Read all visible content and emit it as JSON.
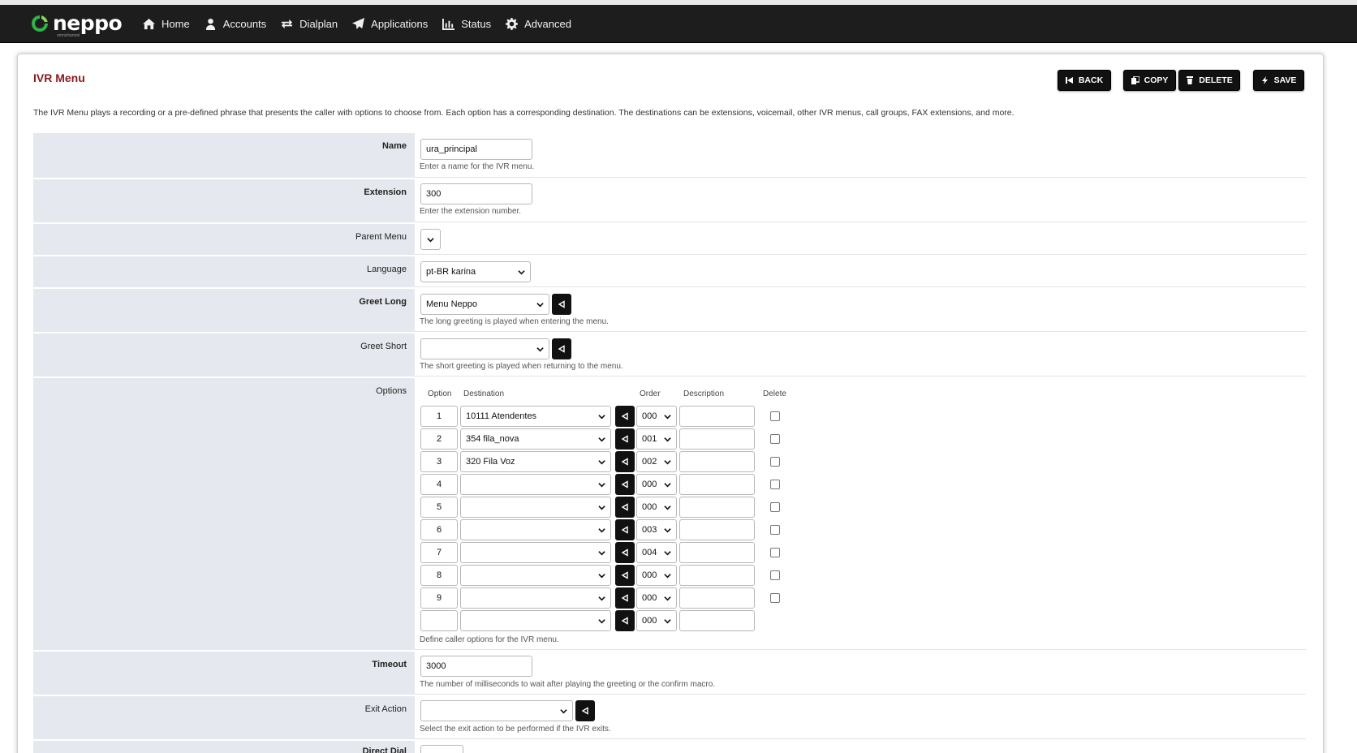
{
  "app": {
    "brand": "neppo",
    "brand_sub": "omnichannel"
  },
  "nav": {
    "items": [
      {
        "label": "Home",
        "icon": "home-icon"
      },
      {
        "label": "Accounts",
        "icon": "user-icon"
      },
      {
        "label": "Dialplan",
        "icon": "exchange-icon"
      },
      {
        "label": "Applications",
        "icon": "paper-plane-icon"
      },
      {
        "label": "Status",
        "icon": "bar-chart-icon"
      },
      {
        "label": "Advanced",
        "icon": "gear-icon"
      }
    ]
  },
  "page": {
    "title": "IVR Menu",
    "description": "The IVR Menu plays a recording or a pre-defined phrase that presents the caller with options to choose from. Each option has a corresponding destination. The destinations can be extensions, voicemail, other IVR menus, call groups, FAX extensions, and more."
  },
  "toolbar": {
    "back_label": "BACK",
    "copy_label": "COPY",
    "delete_label": "DELETE",
    "save_label": "SAVE"
  },
  "form": {
    "name": {
      "label": "Name",
      "value": "ura_principal",
      "hint": "Enter a name for the IVR menu."
    },
    "extension": {
      "label": "Extension",
      "value": "300",
      "hint": "Enter the extension number."
    },
    "parent_menu": {
      "label": "Parent Menu",
      "value": ""
    },
    "language": {
      "label": "Language",
      "value": "pt-BR karina"
    },
    "greet_long": {
      "label": "Greet Long",
      "value": "Menu Neppo",
      "hint": "The long greeting is played when entering the menu."
    },
    "greet_short": {
      "label": "Greet Short",
      "value": "",
      "hint": "The short greeting is played when returning to the menu."
    },
    "options": {
      "label": "Options",
      "headers": {
        "option": "Option",
        "destination": "Destination",
        "order": "Order",
        "description": "Description",
        "delete": "Delete"
      },
      "rows": [
        {
          "option": "1",
          "destination": "10111 Atendentes",
          "order": "000",
          "description": "",
          "deletable": true
        },
        {
          "option": "2",
          "destination": "354 fila_nova",
          "order": "001",
          "description": "",
          "deletable": true
        },
        {
          "option": "3",
          "destination": "320 Fila Voz",
          "order": "002",
          "description": "",
          "deletable": true
        },
        {
          "option": "4",
          "destination": "",
          "order": "000",
          "description": "",
          "deletable": true
        },
        {
          "option": "5",
          "destination": "",
          "order": "000",
          "description": "",
          "deletable": true
        },
        {
          "option": "6",
          "destination": "",
          "order": "003",
          "description": "",
          "deletable": true
        },
        {
          "option": "7",
          "destination": "",
          "order": "004",
          "description": "",
          "deletable": true
        },
        {
          "option": "8",
          "destination": "",
          "order": "000",
          "description": "",
          "deletable": true
        },
        {
          "option": "9",
          "destination": "",
          "order": "000",
          "description": "",
          "deletable": true
        },
        {
          "option": "",
          "destination": "",
          "order": "000",
          "description": "",
          "deletable": false
        }
      ],
      "hint": "Define caller options for the IVR menu."
    },
    "timeout": {
      "label": "Timeout",
      "value": "3000",
      "hint": "The number of milliseconds to wait after playing the greeting or the confirm macro."
    },
    "exit_action": {
      "label": "Exit Action",
      "value": "",
      "hint": "Select the exit action to be performed if the IVR exits."
    },
    "direct_dial": {
      "label": "Direct Dial"
    }
  },
  "colors": {
    "navbar": "#1d1d1d",
    "title": "#8b1a1a",
    "label_bg": "#e5e8ee",
    "button": "#111111"
  }
}
